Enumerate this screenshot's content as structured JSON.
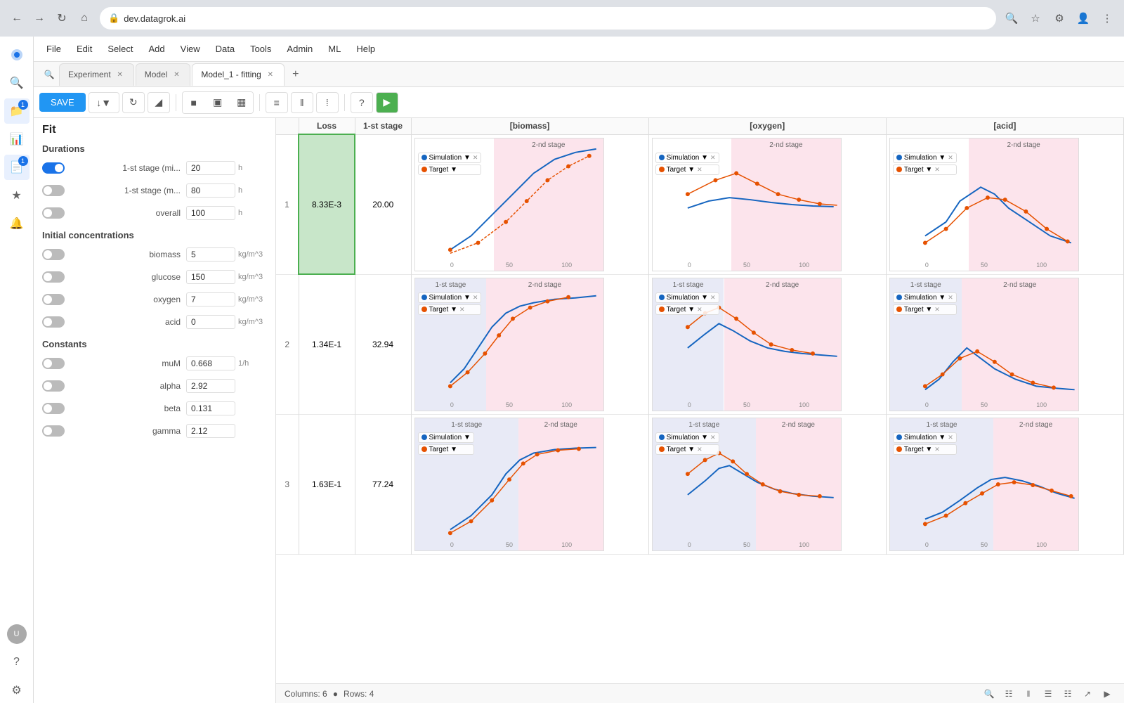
{
  "browser": {
    "url": "dev.datagrok.ai"
  },
  "menu": {
    "items": [
      "File",
      "Edit",
      "Select",
      "Add",
      "View",
      "Data",
      "Tools",
      "Admin",
      "ML",
      "Help"
    ]
  },
  "tabs": [
    {
      "label": "Experiment",
      "active": false,
      "closeable": true
    },
    {
      "label": "Model",
      "active": false,
      "closeable": true
    },
    {
      "label": "Model_1 - fitting",
      "active": true,
      "closeable": true
    }
  ],
  "toolbar": {
    "save_label": "SAVE"
  },
  "panel": {
    "title": "Fit",
    "sections": {
      "durations": {
        "label": "Durations",
        "params": [
          {
            "name": "1-st stage (mi...",
            "value": "20",
            "unit": "h",
            "enabled": true
          },
          {
            "name": "1-st stage (m...",
            "value": "80",
            "unit": "h",
            "enabled": false
          },
          {
            "name": "overall",
            "value": "100",
            "unit": "h",
            "enabled": false
          }
        ]
      },
      "initial_concentrations": {
        "label": "Initial concentrations",
        "params": [
          {
            "name": "biomass",
            "value": "5",
            "unit": "kg/m^3",
            "enabled": false
          },
          {
            "name": "glucose",
            "value": "150",
            "unit": "kg/m^3",
            "enabled": false
          },
          {
            "name": "oxygen",
            "value": "7",
            "unit": "kg/m^3",
            "enabled": false
          },
          {
            "name": "acid",
            "value": "0",
            "unit": "kg/m^3",
            "enabled": false
          }
        ]
      },
      "constants": {
        "label": "Constants",
        "params": [
          {
            "name": "muM",
            "value": "0.668",
            "unit": "1/h",
            "enabled": false
          },
          {
            "name": "alpha",
            "value": "2.92",
            "unit": "",
            "enabled": false
          },
          {
            "name": "beta",
            "value": "0.131",
            "unit": "",
            "enabled": false
          },
          {
            "name": "gamma",
            "value": "2.12",
            "unit": "",
            "enabled": false
          }
        ]
      }
    }
  },
  "grid": {
    "columns": [
      "",
      "Loss",
      "1-st stage",
      "[biomass]",
      "[oxygen]",
      "[acid]"
    ],
    "rows": [
      {
        "num": "1",
        "loss": "8.33E-3",
        "stage": "20.00",
        "highlighted": true
      },
      {
        "num": "2",
        "loss": "1.34E-1",
        "stage": "32.94",
        "highlighted": false
      },
      {
        "num": "3",
        "loss": "1.63E-1",
        "stage": "77.24",
        "highlighted": false
      }
    ]
  },
  "status_bar": {
    "columns_label": "Columns: 6",
    "rows_label": "Rows: 4"
  },
  "colors": {
    "stage1_bg": "#e8eaf6",
    "stage2_bg": "#fce4ec",
    "simulation_line": "#1565c0",
    "target_line": "#e65100",
    "highlight_green": "#c8e6c9",
    "accent_blue": "#1a73e8"
  }
}
